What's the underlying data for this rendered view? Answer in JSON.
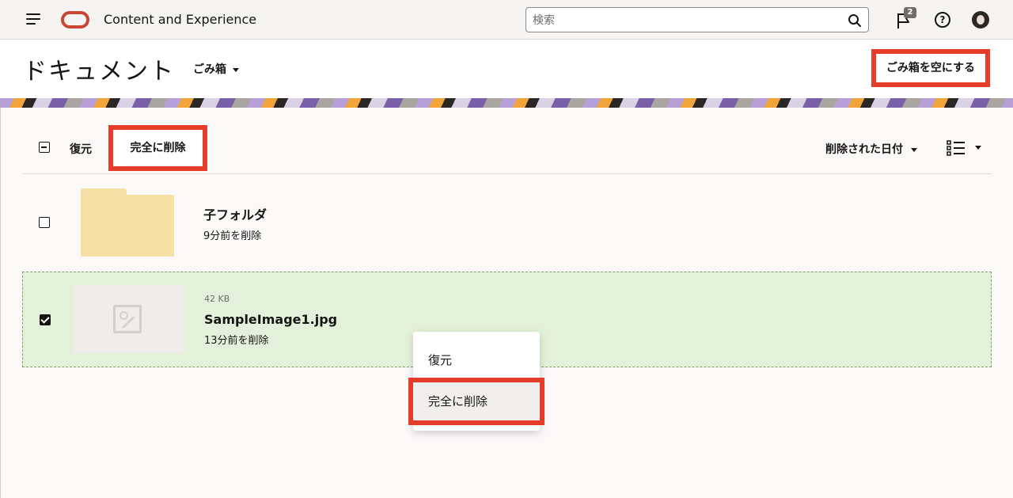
{
  "topbar": {
    "app_title": "Content and Experience",
    "search_placeholder": "検索",
    "notification_count": "2"
  },
  "header": {
    "page_title": "ドキュメント",
    "location": "ごみ箱",
    "empty_trash_label": "ごみ箱を空にする"
  },
  "toolbar": {
    "restore_label": "復元",
    "delete_label": "完全に削除",
    "sort_label": "削除された日付"
  },
  "items": [
    {
      "name": "子フォルダ",
      "deleted": "9分前を削除",
      "type": "folder",
      "selected": false
    },
    {
      "name": "SampleImage1.jpg",
      "size": "42 KB",
      "deleted": "13分前を削除",
      "type": "image",
      "selected": true
    }
  ],
  "context_menu": {
    "restore_label": "復元",
    "delete_label": "完全に削除"
  },
  "colors": {
    "highlight": "#e63c2a",
    "selected_row": "#e4f1da",
    "brand": "#c74634",
    "folder": "#f5e0a6"
  }
}
